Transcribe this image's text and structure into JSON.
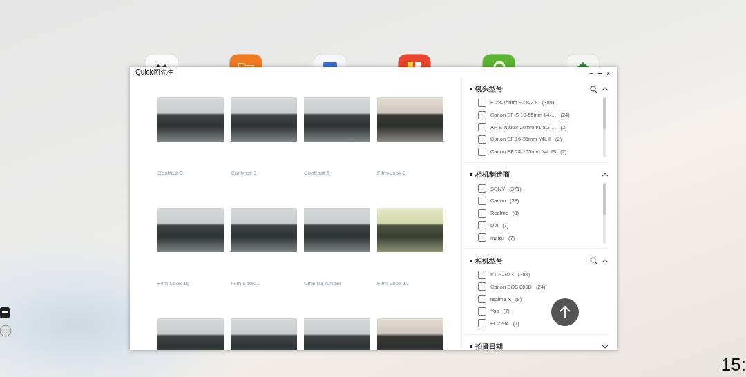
{
  "dock": [
    {
      "kind": "people"
    },
    {
      "kind": "folder"
    },
    {
      "kind": "drive"
    },
    {
      "kind": "media"
    },
    {
      "kind": "sync"
    },
    {
      "kind": "cloud"
    }
  ],
  "window": {
    "title": "Quick图先生",
    "controls": [
      "−",
      "+",
      "×"
    ]
  },
  "photos": [
    {
      "kind": "cool",
      "label": "Contrast 3"
    },
    {
      "kind": "cool",
      "label": "Contrast 2"
    },
    {
      "kind": "cool",
      "label": "Contrast 6"
    },
    {
      "kind": "warm",
      "label": "Film-Look 2"
    },
    {
      "kind": "cool",
      "label": "Film-Look 16"
    },
    {
      "kind": "cool",
      "label": "Film-Look 1"
    },
    {
      "kind": "cool",
      "label": "Cinema-Amber"
    },
    {
      "kind": "green",
      "label": "Film-Look 17"
    },
    {
      "kind": "cool"
    },
    {
      "kind": "cool"
    },
    {
      "kind": "cool"
    },
    {
      "kind": "warm"
    }
  ],
  "filters": [
    {
      "title": "镜头型号",
      "searchable": true,
      "expanded": true,
      "items": [
        {
          "label": "E 28-75mm F2.8-2.8",
          "count": "(389)",
          "checked": false
        },
        {
          "label": "Canon EF-S 18-55mm f/4-…",
          "count": "(24)",
          "checked": false
        },
        {
          "label": "AF-S Nikkor 20mm f/1.8G …",
          "count": "(2)",
          "checked": false
        },
        {
          "label": "Canon EF 16-35mm f/4L II",
          "count": "(2)",
          "checked": false
        },
        {
          "label": "Canon EF 24-105mm f/4L IS",
          "count": "(2)",
          "checked": false
        }
      ]
    },
    {
      "title": "相机制造商",
      "searchable": false,
      "expanded": true,
      "items": [
        {
          "label": "SONY",
          "count": "(371)",
          "checked": false
        },
        {
          "label": "Canon",
          "count": "(38)",
          "checked": false
        },
        {
          "label": "Realme",
          "count": "(8)",
          "checked": false
        },
        {
          "label": "DJI",
          "count": "(7)",
          "checked": false
        },
        {
          "label": "meizu",
          "count": "(7)",
          "checked": false
        }
      ]
    },
    {
      "title": "相机型号",
      "searchable": true,
      "expanded": true,
      "items": [
        {
          "label": "ILCE-7M3",
          "count": "(389)",
          "checked": false
        },
        {
          "label": "Canon EOS 800D",
          "count": "(24)",
          "checked": false
        },
        {
          "label": "realme X",
          "count": "(8)",
          "checked": false
        },
        {
          "label": "Yoo",
          "count": "(7)",
          "checked": false
        },
        {
          "label": "FC2204",
          "count": "(7)",
          "checked": false
        }
      ]
    },
    {
      "title": "拍摄日期",
      "searchable": false,
      "expanded": false
    }
  ],
  "clock": "15:"
}
